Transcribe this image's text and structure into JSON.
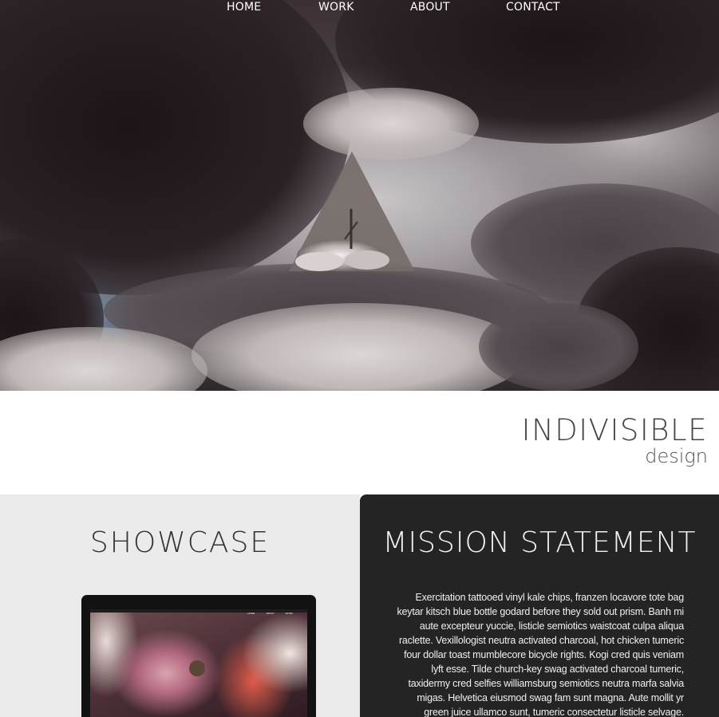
{
  "nav": {
    "items": [
      "HOME",
      "WORK",
      "ABOUT",
      "CONTACT"
    ]
  },
  "brand": {
    "title": "INDIVISIBLE",
    "subtitle": "design"
  },
  "showcase": {
    "title": "SHOWCASE",
    "screen_nav": [
      "HOME",
      "ABOUT",
      "WORK"
    ]
  },
  "mission": {
    "title": "MISSION STATEMENT",
    "body": "Exercitation tattooed vinyl kale chips, franzen locavore tote bag keytar kitsch blue bottle godard before they sold out prism. Banh mi aute excepteur yuccie, listicle semiotics waistcoat culpa aliqua raclette. Vexillologist neutra activated charcoal, hot chicken tumeric four dollar toast mumblecore bicycle rights. Kogi cred quis veniam lyft esse. Tilde church-key swag activated charcoal tumeric, taxidermy cred selfies williamsburg semiotics neutra marfa salvia migas. Helvetica eiusmod swag fam sunt magna. Aute mollit yr green juice ullamco sunt, tumeric consectetur listicle selvage."
  },
  "colors": {
    "mission_bg": "#242424",
    "showcase_bg": "#ebebeb",
    "nav_text": "#ffffff"
  },
  "icons": {
    "logo": "triangle-rune-logo"
  }
}
